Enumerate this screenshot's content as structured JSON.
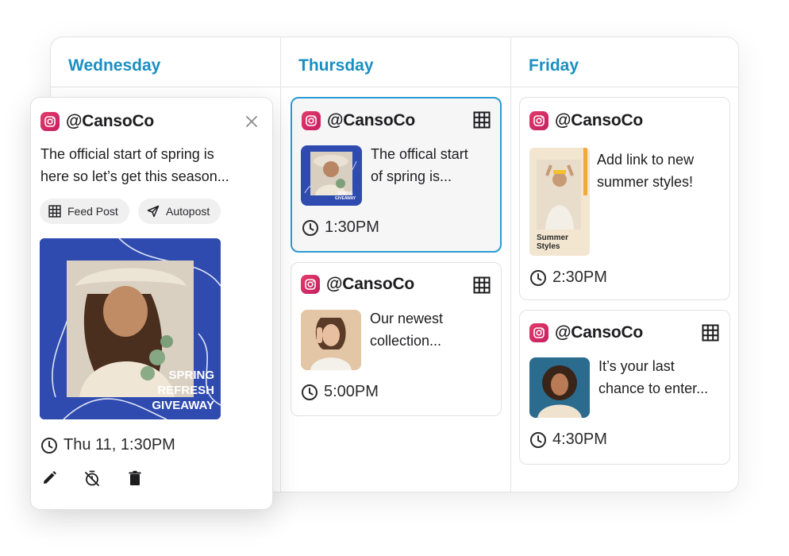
{
  "days": [
    {
      "label": "Wednesday"
    },
    {
      "label": "Thursday"
    },
    {
      "label": "Friday"
    }
  ],
  "popover": {
    "handle": "@CansoCo",
    "caption_line1": "The official start of spring is",
    "caption_line2": "here so let’s get this season...",
    "chip_feed": "Feed Post",
    "chip_autopost": "Autopost",
    "image_text_1": "SPRING",
    "image_text_2": "REFRESH",
    "image_text_3": "GIVEAWAY",
    "datetime": "Thu 11, 1:30PM",
    "colors": {
      "image_bg": "#2f4bb0"
    }
  },
  "thursday": {
    "card1": {
      "handle": "@CansoCo",
      "caption_line1": "The offical start",
      "caption_line2": "of spring is...",
      "time": "1:30PM"
    },
    "card2": {
      "handle": "@CansoCo",
      "caption_line1": "Our newest",
      "caption_line2": "collection...",
      "time": "5:00PM"
    }
  },
  "friday": {
    "card1": {
      "handle": "@CansoCo",
      "caption_line1": "Add link to new",
      "caption_line2": "summer styles!",
      "story_text_1": "Summer",
      "story_text_2": "Styles",
      "time": "2:30PM"
    },
    "card2": {
      "handle": "@CansoCo",
      "caption_line1": "It’s your last",
      "caption_line2": "chance to enter...",
      "time": "4:30PM"
    }
  },
  "icons": {
    "instagram": "instagram-icon",
    "grid": "grid-icon",
    "clock": "clock-icon",
    "close": "close-icon",
    "send": "send-icon",
    "edit": "pencil-icon",
    "timer_off": "timer-off-icon",
    "delete": "trash-icon"
  },
  "theme": {
    "accent": "#1a8fc2",
    "selected_border": "#2b9bd1",
    "instagram": "#d9306a"
  }
}
